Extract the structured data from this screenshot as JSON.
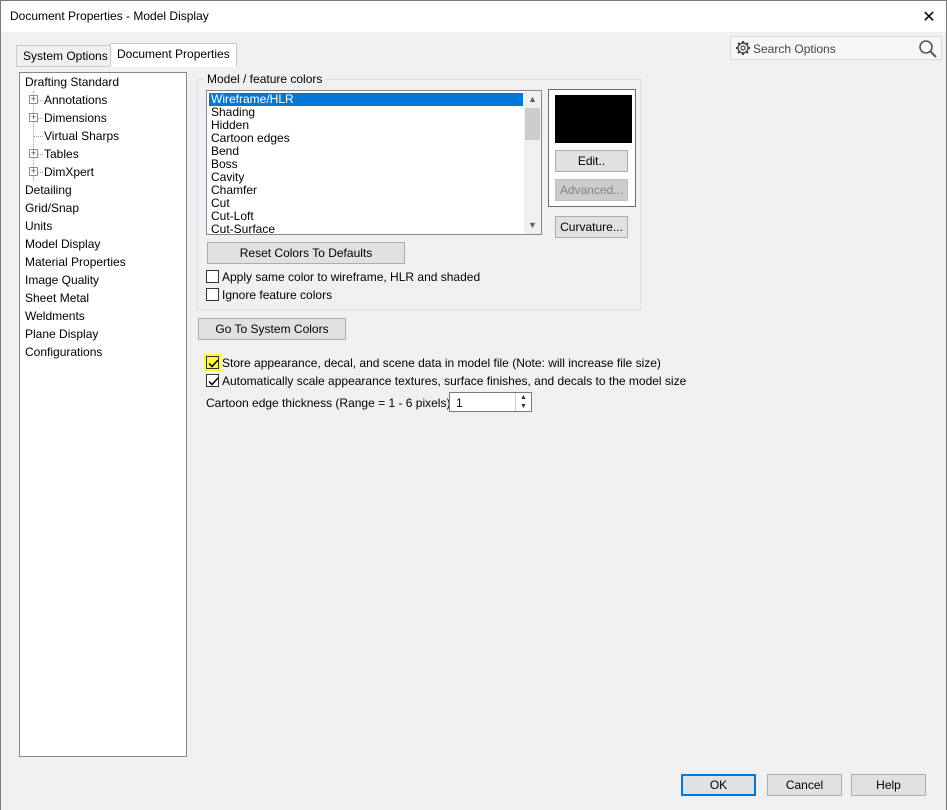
{
  "window": {
    "title": "Document Properties - Model Display"
  },
  "tabs": [
    {
      "label": "System Options",
      "active": false
    },
    {
      "label": "Document Properties",
      "active": true
    }
  ],
  "search": {
    "placeholder": "Search Options"
  },
  "tree": {
    "items": [
      {
        "label": "Drafting Standard"
      },
      {
        "label": "Annotations",
        "expandable": true
      },
      {
        "label": "Dimensions",
        "expandable": true
      },
      {
        "label": "Virtual Sharps"
      },
      {
        "label": "Tables",
        "expandable": true
      },
      {
        "label": "DimXpert",
        "expandable": true
      },
      {
        "label": "Detailing"
      },
      {
        "label": "Grid/Snap"
      },
      {
        "label": "Units"
      },
      {
        "label": "Model Display",
        "selected": true
      },
      {
        "label": "Material Properties"
      },
      {
        "label": "Image Quality"
      },
      {
        "label": "Sheet Metal"
      },
      {
        "label": "Weldments"
      },
      {
        "label": "Plane Display"
      },
      {
        "label": "Configurations"
      }
    ]
  },
  "model_colors": {
    "legend": "Model / feature colors",
    "items": [
      "Wireframe/HLR",
      "Shading",
      "Hidden",
      "Cartoon edges",
      "Bend",
      "Boss",
      "Cavity",
      "Chamfer",
      "Cut",
      "Cut-Loft",
      "Cut-Surface"
    ],
    "selected_index": 0,
    "swatch_color": "#000000",
    "edit_label": "Edit..",
    "advanced_label": "Advanced...",
    "curvature_label": "Curvature...",
    "reset_label": "Reset Colors To Defaults",
    "apply_same_label": "Apply same color to wireframe, HLR and shaded",
    "apply_same_checked": false,
    "ignore_label": "Ignore feature colors",
    "ignore_checked": false
  },
  "goto_system_colors_label": "Go To System Colors",
  "store_appearance": {
    "label": "Store appearance, decal, and scene data in model file (Note: will increase file size)",
    "checked": true
  },
  "auto_scale": {
    "label": "Automatically scale appearance textures, surface finishes, and decals to the model size",
    "checked": true
  },
  "cartoon_edge": {
    "label": "Cartoon edge thickness (Range = 1 - 6 pixels):",
    "value": "1"
  },
  "footer": {
    "ok_label": "OK",
    "cancel_label": "Cancel",
    "help_label": "Help"
  },
  "colors": {
    "accent": "#0078d7",
    "highlight": "#ffff2e"
  }
}
